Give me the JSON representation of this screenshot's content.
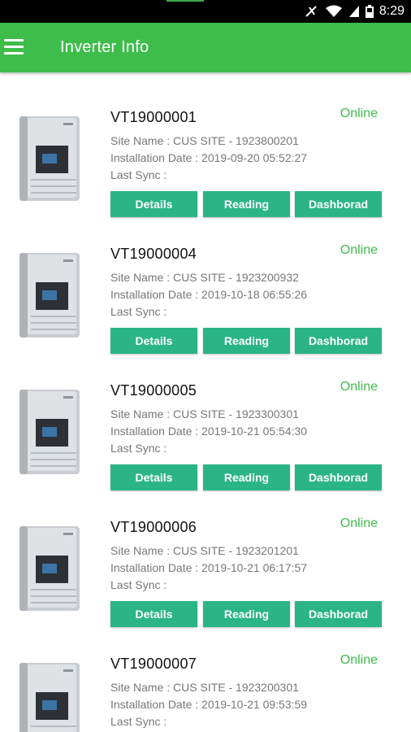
{
  "status_bar": {
    "time": "8:29"
  },
  "app_bar": {
    "title": "Inverter Info"
  },
  "inverters": [
    {
      "id": "VT19000001",
      "status": "Online",
      "site_name": "Site Name : CUS SITE - 1923800201",
      "installation_date": "Installation Date : 2019-09-20 05:52:27",
      "last_sync": "Last Sync :",
      "buttons": {
        "details": "Details",
        "reading": "Reading",
        "dashboard": "Dashborad"
      }
    },
    {
      "id": "VT19000004",
      "status": "Online",
      "site_name": "Site Name : CUS SITE - 1923200932",
      "installation_date": "Installation Date : 2019-10-18 06:55:26",
      "last_sync": "Last Sync :",
      "buttons": {
        "details": "Details",
        "reading": "Reading",
        "dashboard": "Dashborad"
      }
    },
    {
      "id": "VT19000005",
      "status": "Online",
      "site_name": "Site Name : CUS SITE - 1923300301",
      "installation_date": "Installation Date : 2019-10-21 05:54:30",
      "last_sync": "Last Sync :",
      "buttons": {
        "details": "Details",
        "reading": "Reading",
        "dashboard": "Dashborad"
      }
    },
    {
      "id": "VT19000006",
      "status": "Online",
      "site_name": "Site Name : CUS SITE - 1923201201",
      "installation_date": "Installation Date : 2019-10-21 06:17:57",
      "last_sync": "Last Sync :",
      "buttons": {
        "details": "Details",
        "reading": "Reading",
        "dashboard": "Dashborad"
      }
    },
    {
      "id": "VT19000007",
      "status": "Online",
      "site_name": "Site Name : CUS SITE - 1923200301",
      "installation_date": "Installation Date : 2019-10-21 09:53:59",
      "last_sync": "Last Sync :"
    }
  ],
  "colors": {
    "app_bar": "#3ebd4b",
    "button": "#2bb587",
    "online": "#3ebd4b"
  }
}
